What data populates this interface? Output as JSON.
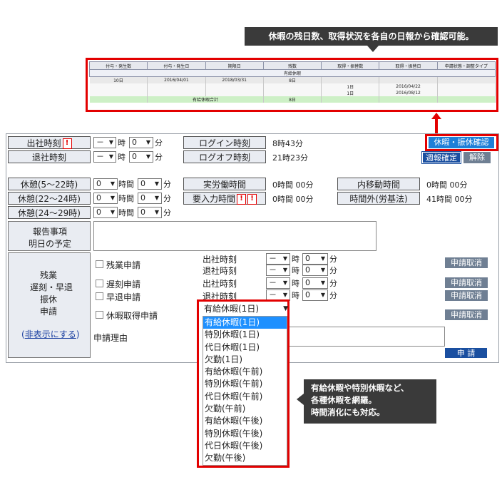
{
  "callouts": {
    "top": "休暇の残日数、取得状況を各自の日報から確認可能。",
    "bottom": [
      "有給休暇や特別休暇など、",
      "各種休暇を網羅。",
      "時間消化にも対応。"
    ]
  },
  "leave_table": {
    "headers": [
      "付与・発生数",
      "付与・発生日",
      "期限日",
      "残数",
      "取得・振替数",
      "取得・振替日",
      "申請状態・調整タイプ"
    ],
    "band": "有給休暇",
    "rows": [
      [
        "10日",
        "2016/04/01",
        "2018/03/31",
        "8日",
        "",
        "",
        ""
      ],
      [
        "",
        "",
        "",
        "",
        "1日",
        "2016/04/22",
        ""
      ],
      [
        "",
        "",
        "",
        "",
        "1日",
        "2016/08/12",
        ""
      ]
    ],
    "total_label": "有給休暇合計",
    "total_value": "8日"
  },
  "form": {
    "labels": {
      "start": "出社時刻",
      "end": "退社時刻",
      "break1": "休憩(5〜22時)",
      "break2": "休憩(22〜24時)",
      "break3": "休憩(24〜29時)",
      "report_line1": "報告事項",
      "report_line2": "明日の予定",
      "login": "ログイン時刻",
      "logoff": "ログオフ時刻",
      "actual": "実労働時間",
      "required": "要入力時間",
      "travel": "内移動時間",
      "overtime_law": "時間外(労基法)"
    },
    "values": {
      "login": "8時43分",
      "logoff": "21時23分",
      "actual": "0時間 00分",
      "required": "0時間 00分",
      "travel": "0時間 00分",
      "overtime_law": "41時間 00分"
    },
    "units": {
      "hour": "時",
      "minute": "分",
      "hours": "時間"
    },
    "select_dash": "－",
    "select_zero": "0",
    "buttons": {
      "leave_confirm": "休暇・振休確認",
      "week_confirm": "週報確定",
      "release": "解除",
      "cancel": "申請取消",
      "apply": "申 請"
    },
    "section": {
      "lines": [
        "残業",
        "遅刻・早退",
        "振休",
        "申請"
      ],
      "hide_link": "非表示にする",
      "paren_open": "(",
      "paren_close": ")"
    },
    "requests": {
      "overtime": "残業申請",
      "late": "遅刻申請",
      "early": "早退申請",
      "leave": "休暇取得申請",
      "reason": "申請理由",
      "start_time": "出社時刻",
      "end_time": "退社時刻",
      "end_time_partial": "退社時刻"
    }
  },
  "dropdown": {
    "current": "有給休暇(1日)",
    "options": [
      "有給休暇(1日)",
      "特別休暇(1日)",
      "代日休暇(1日)",
      "欠勤(1日)",
      "有給休暇(午前)",
      "特別休暇(午前)",
      "代日休暇(午前)",
      "欠勤(午前)",
      "有給休暇(午後)",
      "特別休暇(午後)",
      "代日休暇(午後)",
      "欠勤(午後)"
    ],
    "selected_index": 0
  },
  "colors": {
    "highlight": "#e30000",
    "button_blue": "#1a4fa0",
    "button_gray": "#6f7f93",
    "selected_option": "#1e90ff"
  }
}
